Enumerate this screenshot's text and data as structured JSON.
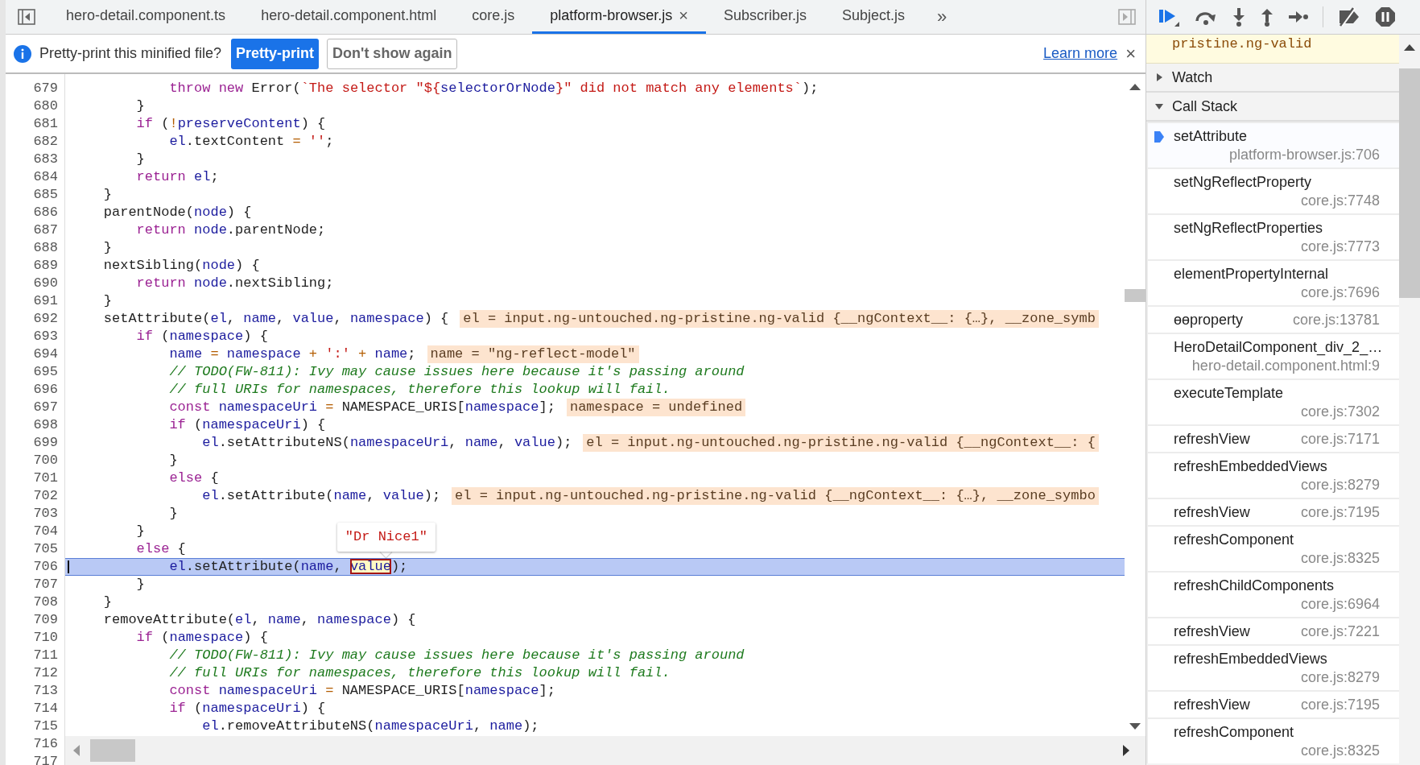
{
  "tabs": [
    {
      "label": "hero-detail.component.ts",
      "selected": false
    },
    {
      "label": "hero-detail.component.html",
      "selected": false
    },
    {
      "label": "core.js",
      "selected": false
    },
    {
      "label": "platform-browser.js",
      "selected": true,
      "close": "×"
    },
    {
      "label": "Subscriber.js",
      "selected": false
    },
    {
      "label": "Subject.js",
      "selected": false
    }
  ],
  "tabs_overflow": "»",
  "infobar": {
    "message": "Pretty-print this minified file?",
    "primary_button": "Pretty-print",
    "secondary_button": "Don't show again",
    "link": "Learn more",
    "close": "×"
  },
  "code": {
    "tooltip": "\"Dr Nice1\"",
    "lines": [
      {
        "number": "679",
        "paused": false,
        "tokens": [
          {
            "kind": "kw",
            "text": "            throw"
          },
          {
            "kind": "kw",
            "text": " new"
          },
          {
            "kind": "txt",
            "text": " Error("
          },
          {
            "kind": "str",
            "text": "`The selector \"${"
          },
          {
            "kind": "var",
            "text": "selectorOrNode"
          },
          {
            "kind": "str",
            "text": "}\" did not match any elements`"
          },
          {
            "kind": "txt",
            "text": ");"
          }
        ]
      },
      {
        "number": "680",
        "paused": false,
        "tokens": [
          {
            "kind": "txt",
            "text": "        }"
          }
        ]
      },
      {
        "number": "681",
        "paused": false,
        "tokens": [
          {
            "kind": "kw",
            "text": "        if"
          },
          {
            "kind": "txt",
            "text": " ("
          },
          {
            "kind": "op",
            "text": "!"
          },
          {
            "kind": "var",
            "text": "preserveContent"
          },
          {
            "kind": "txt",
            "text": ") {"
          }
        ]
      },
      {
        "number": "682",
        "paused": false,
        "tokens": [
          {
            "kind": "var",
            "text": "            el"
          },
          {
            "kind": "txt",
            "text": ".textContent "
          },
          {
            "kind": "op",
            "text": "="
          },
          {
            "kind": "str",
            "text": " ''"
          },
          {
            "kind": "txt",
            "text": ";"
          }
        ]
      },
      {
        "number": "683",
        "paused": false,
        "tokens": [
          {
            "kind": "txt",
            "text": "        }"
          }
        ]
      },
      {
        "number": "684",
        "paused": false,
        "tokens": [
          {
            "kind": "kw",
            "text": "        return"
          },
          {
            "kind": "var",
            "text": " el"
          },
          {
            "kind": "txt",
            "text": ";"
          }
        ]
      },
      {
        "number": "685",
        "paused": false,
        "tokens": [
          {
            "kind": "txt",
            "text": "    }"
          }
        ]
      },
      {
        "number": "686",
        "paused": false,
        "tokens": [
          {
            "kind": "txt",
            "text": "    parentNode("
          },
          {
            "kind": "var",
            "text": "node"
          },
          {
            "kind": "txt",
            "text": ") {"
          }
        ]
      },
      {
        "number": "687",
        "paused": false,
        "tokens": [
          {
            "kind": "kw",
            "text": "        return"
          },
          {
            "kind": "var",
            "text": " node"
          },
          {
            "kind": "txt",
            "text": ".parentNode;"
          }
        ]
      },
      {
        "number": "688",
        "paused": false,
        "tokens": [
          {
            "kind": "txt",
            "text": "    }"
          }
        ]
      },
      {
        "number": "689",
        "paused": false,
        "tokens": [
          {
            "kind": "txt",
            "text": "    nextSibling("
          },
          {
            "kind": "var",
            "text": "node"
          },
          {
            "kind": "txt",
            "text": ") {"
          }
        ]
      },
      {
        "number": "690",
        "paused": false,
        "tokens": [
          {
            "kind": "kw",
            "text": "        return"
          },
          {
            "kind": "var",
            "text": " node"
          },
          {
            "kind": "txt",
            "text": ".nextSibling;"
          }
        ]
      },
      {
        "number": "691",
        "paused": false,
        "tokens": [
          {
            "kind": "txt",
            "text": "    }"
          }
        ]
      },
      {
        "number": "692",
        "paused": false,
        "tokens": [
          {
            "kind": "txt",
            "text": "    setAttribute("
          },
          {
            "kind": "var",
            "text": "el"
          },
          {
            "kind": "txt",
            "text": ", "
          },
          {
            "kind": "var",
            "text": "name"
          },
          {
            "kind": "txt",
            "text": ", "
          },
          {
            "kind": "var",
            "text": "value"
          },
          {
            "kind": "txt",
            "text": ", "
          },
          {
            "kind": "var",
            "text": "namespace"
          },
          {
            "kind": "txt",
            "text": ") {"
          }
        ],
        "inline_value": "el = input.ng-untouched.ng-pristine.ng-valid {__ngContext__: {…}, __zone_symb"
      },
      {
        "number": "693",
        "paused": false,
        "tokens": [
          {
            "kind": "kw",
            "text": "        if"
          },
          {
            "kind": "txt",
            "text": " ("
          },
          {
            "kind": "var",
            "text": "namespace"
          },
          {
            "kind": "txt",
            "text": ") {"
          }
        ]
      },
      {
        "number": "694",
        "paused": false,
        "tokens": [
          {
            "kind": "var",
            "text": "            name"
          },
          {
            "kind": "op",
            "text": " ="
          },
          {
            "kind": "var",
            "text": " namespace"
          },
          {
            "kind": "op",
            "text": " +"
          },
          {
            "kind": "str",
            "text": " ':'"
          },
          {
            "kind": "op",
            "text": " +"
          },
          {
            "kind": "var",
            "text": " name"
          },
          {
            "kind": "txt",
            "text": ";"
          }
        ],
        "inline_value": "name = \"ng-reflect-model\""
      },
      {
        "number": "695",
        "paused": false,
        "tokens": [
          {
            "kind": "com",
            "text": "            // TODO(FW-811): Ivy may cause issues here because it's passing around"
          }
        ]
      },
      {
        "number": "696",
        "paused": false,
        "tokens": [
          {
            "kind": "com",
            "text": "            // full URIs for namespaces, therefore this lookup will fail."
          }
        ]
      },
      {
        "number": "697",
        "paused": false,
        "tokens": [
          {
            "kind": "kw",
            "text": "            const"
          },
          {
            "kind": "var",
            "text": " namespaceUri"
          },
          {
            "kind": "op",
            "text": " ="
          },
          {
            "kind": "txt",
            "text": " NAMESPACE_URIS["
          },
          {
            "kind": "var",
            "text": "namespace"
          },
          {
            "kind": "txt",
            "text": "];"
          }
        ],
        "inline_value": "namespace = undefined"
      },
      {
        "number": "698",
        "paused": false,
        "tokens": [
          {
            "kind": "kw",
            "text": "            if"
          },
          {
            "kind": "txt",
            "text": " ("
          },
          {
            "kind": "var",
            "text": "namespaceUri"
          },
          {
            "kind": "txt",
            "text": ") {"
          }
        ]
      },
      {
        "number": "699",
        "paused": false,
        "tokens": [
          {
            "kind": "var",
            "text": "                el"
          },
          {
            "kind": "txt",
            "text": ".setAttributeNS("
          },
          {
            "kind": "var",
            "text": "namespaceUri"
          },
          {
            "kind": "txt",
            "text": ", "
          },
          {
            "kind": "var",
            "text": "name"
          },
          {
            "kind": "txt",
            "text": ", "
          },
          {
            "kind": "var",
            "text": "value"
          },
          {
            "kind": "txt",
            "text": ");"
          }
        ],
        "inline_value": "el = input.ng-untouched.ng-pristine.ng-valid {__ngContext__: {"
      },
      {
        "number": "700",
        "paused": false,
        "tokens": [
          {
            "kind": "txt",
            "text": "            }"
          }
        ]
      },
      {
        "number": "701",
        "paused": false,
        "tokens": [
          {
            "kind": "kw",
            "text": "            else"
          },
          {
            "kind": "txt",
            "text": " {"
          }
        ]
      },
      {
        "number": "702",
        "paused": false,
        "tokens": [
          {
            "kind": "var",
            "text": "                el"
          },
          {
            "kind": "txt",
            "text": ".setAttribute("
          },
          {
            "kind": "var",
            "text": "name"
          },
          {
            "kind": "txt",
            "text": ", "
          },
          {
            "kind": "var",
            "text": "value"
          },
          {
            "kind": "txt",
            "text": ");"
          }
        ],
        "inline_value": "el = input.ng-untouched.ng-pristine.ng-valid {__ngContext__: {…}, __zone_symbo"
      },
      {
        "number": "703",
        "paused": false,
        "tokens": [
          {
            "kind": "txt",
            "text": "            }"
          }
        ]
      },
      {
        "number": "704",
        "paused": false,
        "tokens": [
          {
            "kind": "txt",
            "text": "        }"
          }
        ]
      },
      {
        "number": "705",
        "paused": false,
        "tokens": [
          {
            "kind": "kw",
            "text": "        else"
          },
          {
            "kind": "txt",
            "text": " {"
          }
        ]
      },
      {
        "number": "706",
        "paused": true,
        "tokens": [
          {
            "kind": "var",
            "text": "            el"
          },
          {
            "kind": "txt",
            "text": ".setAttribute("
          },
          {
            "kind": "var",
            "text": "name"
          },
          {
            "kind": "txt",
            "text": ", "
          },
          {
            "kind": "hover",
            "text": "value"
          },
          {
            "kind": "txt",
            "text": ");"
          }
        ]
      },
      {
        "number": "707",
        "paused": false,
        "tokens": [
          {
            "kind": "txt",
            "text": "        }"
          }
        ]
      },
      {
        "number": "708",
        "paused": false,
        "tokens": [
          {
            "kind": "txt",
            "text": "    }"
          }
        ]
      },
      {
        "number": "709",
        "paused": false,
        "tokens": [
          {
            "kind": "txt",
            "text": "    removeAttribute("
          },
          {
            "kind": "var",
            "text": "el"
          },
          {
            "kind": "txt",
            "text": ", "
          },
          {
            "kind": "var",
            "text": "name"
          },
          {
            "kind": "txt",
            "text": ", "
          },
          {
            "kind": "var",
            "text": "namespace"
          },
          {
            "kind": "txt",
            "text": ") {"
          }
        ]
      },
      {
        "number": "710",
        "paused": false,
        "tokens": [
          {
            "kind": "kw",
            "text": "        if"
          },
          {
            "kind": "txt",
            "text": " ("
          },
          {
            "kind": "var",
            "text": "namespace"
          },
          {
            "kind": "txt",
            "text": ") {"
          }
        ]
      },
      {
        "number": "711",
        "paused": false,
        "tokens": [
          {
            "kind": "com",
            "text": "            // TODO(FW-811): Ivy may cause issues here because it's passing around"
          }
        ]
      },
      {
        "number": "712",
        "paused": false,
        "tokens": [
          {
            "kind": "com",
            "text": "            // full URIs for namespaces, therefore this lookup will fail."
          }
        ]
      },
      {
        "number": "713",
        "paused": false,
        "tokens": [
          {
            "kind": "kw",
            "text": "            const"
          },
          {
            "kind": "var",
            "text": " namespaceUri"
          },
          {
            "kind": "op",
            "text": " ="
          },
          {
            "kind": "txt",
            "text": " NAMESPACE_URIS["
          },
          {
            "kind": "var",
            "text": "namespace"
          },
          {
            "kind": "txt",
            "text": "];"
          }
        ]
      },
      {
        "number": "714",
        "paused": false,
        "tokens": [
          {
            "kind": "kw",
            "text": "            if"
          },
          {
            "kind": "txt",
            "text": " ("
          },
          {
            "kind": "var",
            "text": "namespaceUri"
          },
          {
            "kind": "txt",
            "text": ") {"
          }
        ]
      },
      {
        "number": "715",
        "paused": false,
        "tokens": [
          {
            "kind": "var",
            "text": "                el"
          },
          {
            "kind": "txt",
            "text": ".removeAttributeNS("
          },
          {
            "kind": "var",
            "text": "namespaceUri"
          },
          {
            "kind": "txt",
            "text": ", "
          },
          {
            "kind": "var",
            "text": "name"
          },
          {
            "kind": "txt",
            "text": ");"
          }
        ]
      }
    ],
    "hidden_line_numbers": [
      "716",
      "717"
    ]
  },
  "scope_preview": "pristine.ng-valid",
  "sections": [
    {
      "title": "Watch",
      "expanded": false
    },
    {
      "title": "Call Stack",
      "expanded": true
    }
  ],
  "call_stack": [
    {
      "function": "setAttribute",
      "location": "platform-browser.js:706",
      "selected": true
    },
    {
      "function": "setNgReflectProperty",
      "location": "core.js:7748",
      "selected": false
    },
    {
      "function": "setNgReflectProperties",
      "location": "core.js:7773",
      "selected": false
    },
    {
      "function": "elementPropertyInternal",
      "location": "core.js:7696",
      "selected": false
    },
    {
      "function": "ɵɵproperty",
      "location": "core.js:13781",
      "selected": false
    },
    {
      "function": "HeroDetailComponent_div_2_…",
      "location": "hero-detail.component.html:9",
      "selected": false
    },
    {
      "function": "executeTemplate",
      "location": "core.js:7302",
      "selected": false
    },
    {
      "function": "refreshView",
      "location": "core.js:7171",
      "selected": false
    },
    {
      "function": "refreshEmbeddedViews",
      "location": "core.js:8279",
      "selected": false
    },
    {
      "function": "refreshView",
      "location": "core.js:7195",
      "selected": false
    },
    {
      "function": "refreshComponent",
      "location": "core.js:8325",
      "selected": false
    },
    {
      "function": "refreshChildComponents",
      "location": "core.js:6964",
      "selected": false
    },
    {
      "function": "refreshView",
      "location": "core.js:7221",
      "selected": false
    },
    {
      "function": "refreshEmbeddedViews",
      "location": "core.js:8279",
      "selected": false
    },
    {
      "function": "refreshView",
      "location": "core.js:7195",
      "selected": false
    },
    {
      "function": "refreshComponent",
      "location": "core.js:8325",
      "selected": false
    }
  ]
}
